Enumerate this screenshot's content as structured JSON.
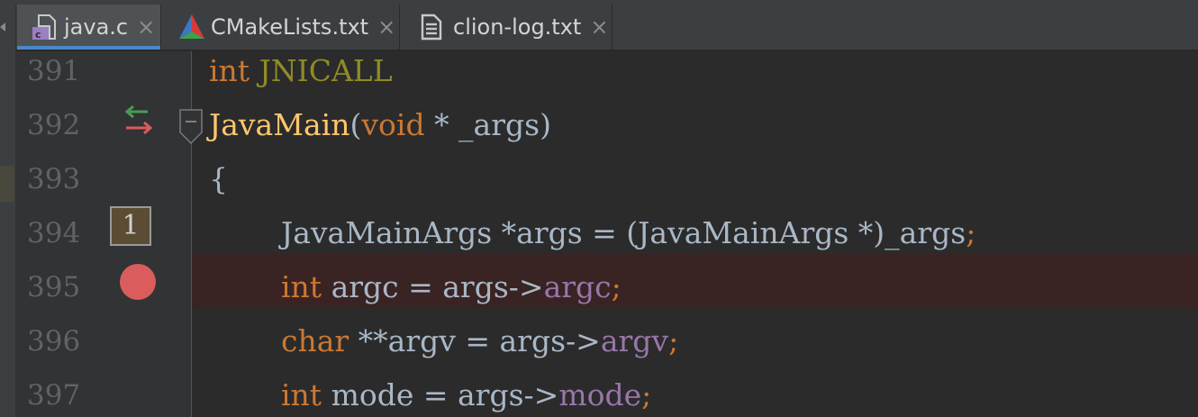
{
  "tabs": [
    {
      "label": "java.c",
      "icon": "c-file-icon",
      "active": true
    },
    {
      "label": "CMakeLists.txt",
      "icon": "cmake-icon",
      "active": false
    },
    {
      "label": "clion-log.txt",
      "icon": "text-file-icon",
      "active": false
    }
  ],
  "tab_close_glyph": "×",
  "gutter": {
    "line_numbers": [
      "391",
      "392",
      "393",
      "394",
      "395",
      "396",
      "397"
    ],
    "badge_text": "1"
  },
  "code": {
    "l391": {
      "kw": "int",
      "macro": "JNICALL"
    },
    "l392": {
      "fn": "JavaMain",
      "open": "(",
      "kw": "void",
      "rest": " * _args)"
    },
    "l393": {
      "text": "{"
    },
    "l394": {
      "text": "JavaMainArgs *args = (JavaMainArgs *)_args",
      "semi": ";"
    },
    "l395": {
      "kw": "int",
      "rest": " argc = args->",
      "field": "argc",
      "semi": ";"
    },
    "l396": {
      "kw": "char",
      "rest": " **argv = args->",
      "field": "argv",
      "semi": ";"
    },
    "l397": {
      "kw": "int",
      "rest": " mode = args->",
      "field": "mode",
      "semi": ";"
    }
  },
  "colors": {
    "keyword": "#cc7832",
    "function": "#ffc66d",
    "field": "#9876aa",
    "macro": "#908b25",
    "breakpoint": "#db5c5c",
    "active_tab_underline": "#4a88c7"
  }
}
